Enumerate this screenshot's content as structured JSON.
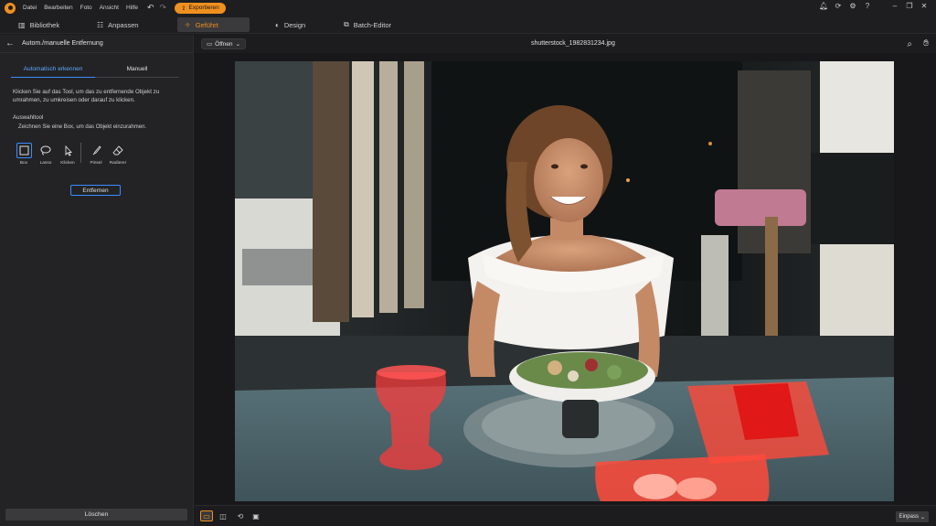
{
  "menu": {
    "items": [
      "Datei",
      "Bearbeiten",
      "Foto",
      "Ansicht",
      "Hilfe"
    ],
    "export_label": "Exportieren"
  },
  "tabs": [
    {
      "label": "Bibliothek",
      "icon": "library-icon"
    },
    {
      "label": "Anpassen",
      "icon": "sliders-icon"
    },
    {
      "label": "Geführt",
      "icon": "magic-wand-icon",
      "active": true
    },
    {
      "label": "Design",
      "icon": "palette-icon"
    },
    {
      "label": "Batch-Editor",
      "icon": "batch-icon"
    }
  ],
  "left_panel": {
    "title": "Autom./manuelle Entfernung",
    "subtabs": [
      {
        "label": "Automatisch erkennen",
        "active": true
      },
      {
        "label": "Manuell",
        "active": false
      }
    ],
    "instructions": "Klicken Sie auf das Tool, um das zu entfernende Objekt zu umrahmen, zu umkreisen oder darauf zu klicken.",
    "selection_label": "Auswahltool",
    "selection_hint": "Zeichnen Sie eine Box, um das Objekt einzurahmen.",
    "tools": [
      {
        "label": "Box",
        "icon": "box-select-icon",
        "active": true
      },
      {
        "label": "Lasso",
        "icon": "lasso-icon"
      },
      {
        "label": "Klicken",
        "icon": "cursor-click-icon"
      },
      {
        "label": "Pinsel",
        "icon": "brush-icon"
      },
      {
        "label": "Radierer",
        "icon": "eraser-icon"
      }
    ],
    "remove_label": "Entfernen",
    "clear_label": "Löschen"
  },
  "canvas": {
    "open_label": "Öffnen",
    "file_name": "shutterstock_1982831234.jpg",
    "fit_label": "Einpass"
  },
  "colors": {
    "accent": "#f0901e",
    "selection_blue": "#3b8cff",
    "mask_red": "#ff3a3a"
  }
}
